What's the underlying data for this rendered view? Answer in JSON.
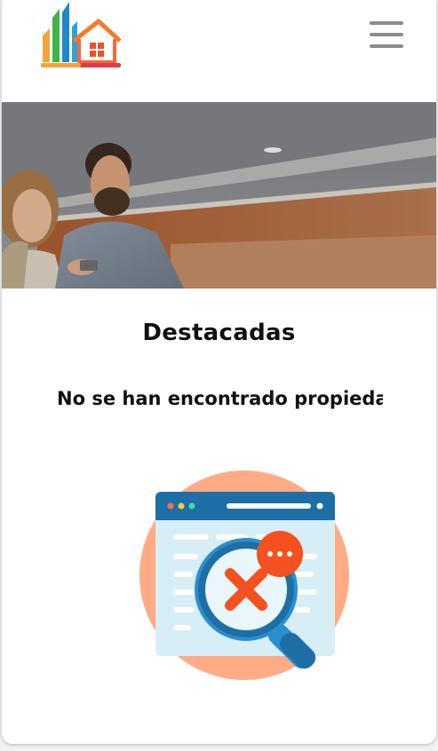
{
  "header": {
    "logo_icon": "real-estate-buildings-house-logo-icon",
    "menu_icon": "hamburger-menu-icon"
  },
  "hero": {
    "image": "couple-looking-at-phone-photo"
  },
  "featured": {
    "title": "Destacadas",
    "empty_message": "No se han encontrado propiedades",
    "illustration": "search-no-results-illustration"
  },
  "colors": {
    "logo_green": "#3cb54a",
    "logo_blue": "#1e88c8",
    "logo_orange": "#f57c28",
    "logo_red": "#e63946",
    "illustration_circle": "#ffab85",
    "browser_bar": "#1d6fa5",
    "magnifier_ring": "#2b8ecf",
    "error_red": "#f4511e"
  }
}
